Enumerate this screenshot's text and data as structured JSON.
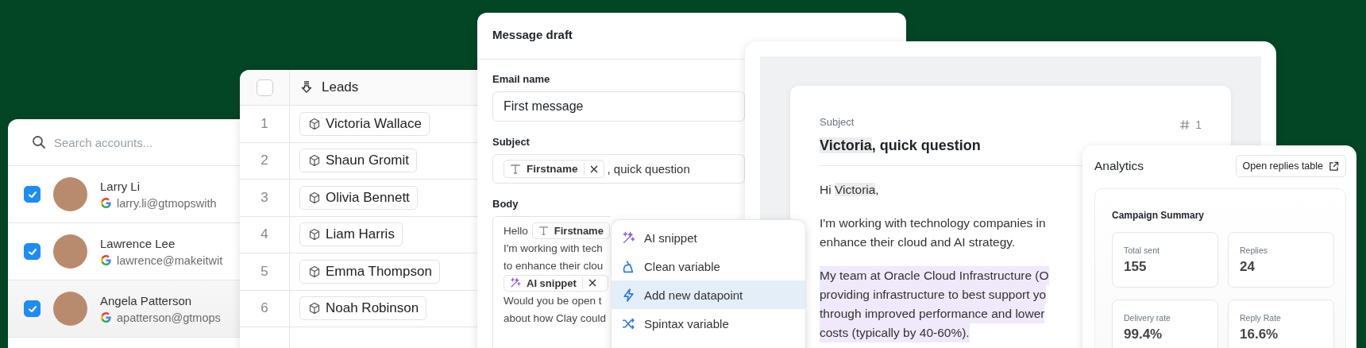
{
  "accounts_panel": {
    "search": {
      "placeholder": "Search accounts..."
    },
    "accounts": [
      {
        "name": "Larry Li",
        "email": "larry.li@gtmopswith",
        "checked": true
      },
      {
        "name": "Lawrence Lee",
        "email": "lawrence@makeitwit",
        "checked": true
      },
      {
        "name": "Angela Patterson",
        "email": "apatterson@gtmops",
        "checked": true
      }
    ]
  },
  "leads_table": {
    "header_checked": false,
    "column": "Leads",
    "rows": [
      {
        "number": "1",
        "name": "Victoria Wallace"
      },
      {
        "number": "2",
        "name": "Shaun Gromit"
      },
      {
        "number": "3",
        "name": "Olivia Bennett"
      },
      {
        "number": "4",
        "name": "Liam Harris"
      },
      {
        "number": "5",
        "name": "Emma Thompson"
      },
      {
        "number": "6",
        "name": "Noah Robinson"
      }
    ]
  },
  "message_draft": {
    "title": "Message draft",
    "email_name": {
      "label": "Email name",
      "value": "First message"
    },
    "subject": {
      "label": "Subject",
      "variable": "Firstname",
      "text": ", quick question"
    },
    "body": {
      "label": "Body",
      "lines": [
        {
          "kind": "text_variable",
          "text": "Hello",
          "variable": "Firstname"
        },
        {
          "kind": "text",
          "text": "I'm working with tech"
        },
        {
          "kind": "text",
          "text": "to enhance their clou"
        },
        {
          "kind": "snippet",
          "variable": "AI snippet"
        },
        {
          "kind": "text",
          "text": "Would you be open t"
        },
        {
          "kind": "text",
          "text": "about how Clay could"
        }
      ]
    }
  },
  "insert_menu": {
    "items": [
      {
        "kind": "ai",
        "label": "AI snippet",
        "selected": false
      },
      {
        "kind": "clean",
        "label": "Clean variable",
        "selected": false
      },
      {
        "kind": "datapoint",
        "label": "Add new datapoint",
        "selected": true
      },
      {
        "kind": "spintax",
        "label": "Spintax variable",
        "selected": false
      }
    ]
  },
  "email_preview": {
    "subject_label": "Subject",
    "subject_variable": "Victoria",
    "subject_rest": ", quick question",
    "number": "1",
    "greeting": {
      "text": "Hi ",
      "variable": "Victoria",
      "rest": ","
    },
    "paragraphs": [
      {
        "highlighted": false,
        "lines": [
          "I'm working with technology companies in",
          "enhance their cloud and AI strategy."
        ]
      },
      {
        "highlighted": true,
        "lines": [
          "My team at Oracle Cloud Infrastructure (O",
          "providing infrastructure to best support yo",
          "through improved performance and lower",
          "costs (typically by 40-60%)."
        ]
      }
    ]
  },
  "analytics": {
    "title": "Analytics",
    "button": "Open replies table",
    "summary_title": "Campaign Summary",
    "stats": [
      {
        "label": "Total sent",
        "value": "155"
      },
      {
        "label": "Replies",
        "value": "24"
      },
      {
        "label": "Delivery rate",
        "value": "99.4%"
      },
      {
        "label": "Reply Rate",
        "value": "16.6%"
      }
    ]
  }
}
